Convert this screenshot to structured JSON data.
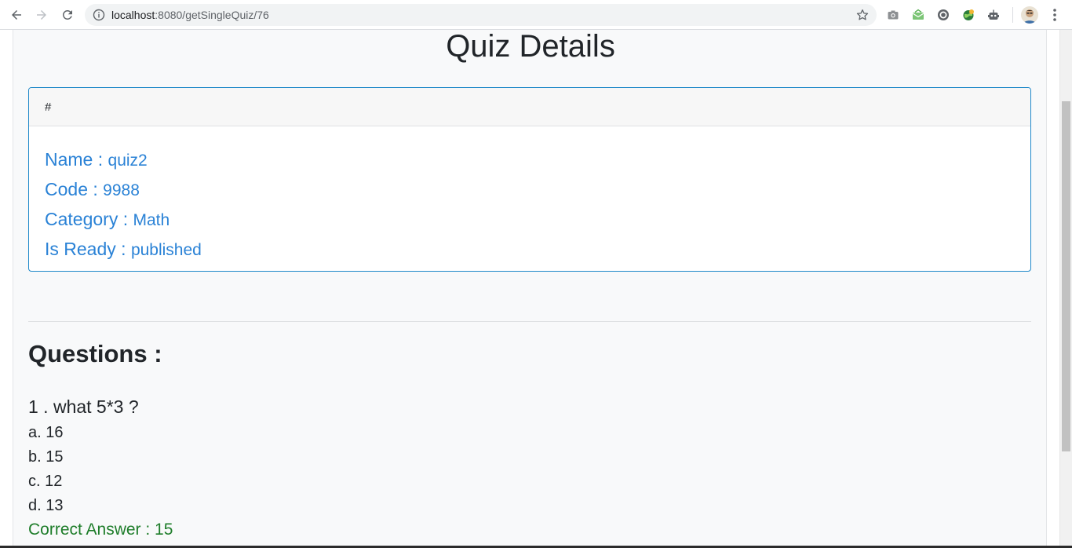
{
  "browser": {
    "url_host": "localhost",
    "url_path": ":8080/getSingleQuiz/76"
  },
  "page": {
    "title": "Quiz Details"
  },
  "card": {
    "header": "#",
    "details": [
      {
        "label": "Name : ",
        "value": "quiz2"
      },
      {
        "label": "Code : ",
        "value": "9988"
      },
      {
        "label": "Category : ",
        "value": "Math"
      },
      {
        "label": "Is Ready : ",
        "value": "published"
      }
    ]
  },
  "questions": {
    "heading": "Questions :",
    "items": [
      {
        "text": "1 . what 5*3 ?",
        "options": [
          "a. 16",
          "b. 15",
          "c. 12",
          "d. 13"
        ],
        "correct": "Correct Answer : 15"
      }
    ]
  },
  "colors": {
    "accent": "#2a82d6",
    "card_border": "#1e88c9",
    "correct": "#1e7d2a",
    "page_bg": "#f8f9fa"
  }
}
